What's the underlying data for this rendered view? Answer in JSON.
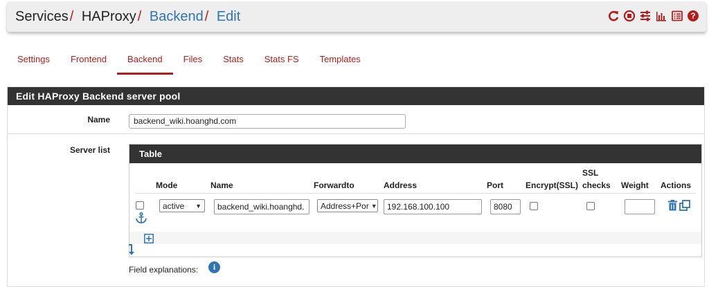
{
  "breadcrumb": {
    "services": "Services",
    "haproxy": "HAProxy",
    "backend": "Backend",
    "edit": "Edit",
    "separator": "/"
  },
  "header_icons": [
    "reload-icon",
    "stop-icon",
    "settings-sliders-icon",
    "chart-icon",
    "list-icon",
    "help-icon"
  ],
  "tabs": [
    {
      "label": "Settings"
    },
    {
      "label": "Frontend"
    },
    {
      "label": "Backend"
    },
    {
      "label": "Files"
    },
    {
      "label": "Stats"
    },
    {
      "label": "Stats FS"
    },
    {
      "label": "Templates"
    }
  ],
  "active_tab": "Backend",
  "form": {
    "heading": "Edit HAProxy Backend server pool",
    "name_label": "Name",
    "name_value": "backend_wiki.hoanghd.com",
    "server_list_label": "Server list"
  },
  "server_table": {
    "heading": "Table",
    "columns": {
      "mode": "Mode",
      "name": "Name",
      "forwardto": "Forwardto",
      "address": "Address",
      "port": "Port",
      "encrypt": "Encrypt(SSL)",
      "ssl_checks_1": "SSL",
      "ssl_checks_2": "checks",
      "weight": "Weight",
      "actions": "Actions"
    },
    "rows": [
      {
        "selected": false,
        "mode": "active",
        "name": "backend_wiki.hoanghd.",
        "forwardto": "Address+Por",
        "address": "192.168.100.100",
        "port": "8080",
        "encrypt_ssl": false,
        "ssl_checks": false,
        "weight": ""
      }
    ]
  },
  "field_explanations": "Field explanations:",
  "colors": {
    "accent_red": "#b71c1c",
    "link_blue": "#2f74b5",
    "heading_dark": "#333333"
  }
}
